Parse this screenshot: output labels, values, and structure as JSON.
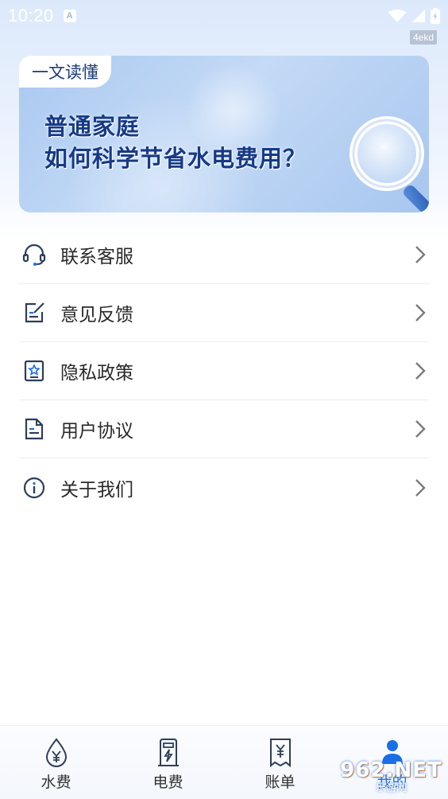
{
  "status_bar": {
    "time": "10:20",
    "notification_letter": "A"
  },
  "watermark_tag": "4ekd",
  "banner": {
    "tag": "一文读懂",
    "title_line1": "普通家庭",
    "title_line2": "如何科学节省水电费用？"
  },
  "menu": {
    "items": [
      {
        "label": "联系客服",
        "icon": "headset-icon"
      },
      {
        "label": "意见反馈",
        "icon": "feedback-edit-icon"
      },
      {
        "label": "隐私政策",
        "icon": "privacy-star-icon"
      },
      {
        "label": "用户协议",
        "icon": "document-icon"
      },
      {
        "label": "关于我们",
        "icon": "info-icon"
      }
    ]
  },
  "bottom_nav": {
    "items": [
      {
        "label": "水费",
        "icon": "water-drop-yen-icon"
      },
      {
        "label": "电费",
        "icon": "electricity-meter-icon"
      },
      {
        "label": "账单",
        "icon": "bill-yen-icon"
      },
      {
        "label": "我的",
        "icon": "user-icon",
        "active": true
      }
    ]
  },
  "overlay_badge": {
    "big": "962",
    "suffix": ".NET",
    "small": "乐游网"
  },
  "colors": {
    "accent": "#1a6ee8",
    "banner_title": "#163a86",
    "icon": "#2c3e5a"
  }
}
